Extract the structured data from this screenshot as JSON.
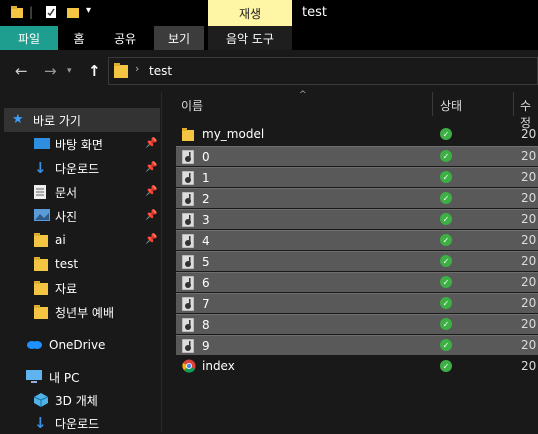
{
  "titlebar": {
    "contextual_tab": "재생",
    "title": "test"
  },
  "ribbon": {
    "tabs": [
      "파일",
      "홈",
      "공유",
      "보기",
      "음악 도구"
    ]
  },
  "address": {
    "path": "test"
  },
  "sidebar": {
    "quick_access": "바로 가기",
    "items": [
      {
        "label": "바탕 화면",
        "icon": "desktop-icon",
        "pinned": true
      },
      {
        "label": "다운로드",
        "icon": "download-icon",
        "pinned": true
      },
      {
        "label": "문서",
        "icon": "document-icon",
        "pinned": true
      },
      {
        "label": "사진",
        "icon": "pictures-icon",
        "pinned": true
      },
      {
        "label": "ai",
        "icon": "folder-icon",
        "pinned": true
      },
      {
        "label": "test",
        "icon": "folder-icon",
        "pinned": false
      },
      {
        "label": "자료",
        "icon": "folder-icon",
        "pinned": false
      },
      {
        "label": "청년부 예배",
        "icon": "folder-icon",
        "pinned": false
      }
    ],
    "onedrive": "OneDrive",
    "this_pc": "내 PC",
    "pc_items": [
      {
        "label": "3D 개체",
        "icon": "3d-objects-icon"
      },
      {
        "label": "다운로드",
        "icon": "download-icon"
      }
    ]
  },
  "columns": {
    "name": "이름",
    "status": "상태",
    "modified": "수정"
  },
  "files": [
    {
      "name": "my_model",
      "type": "folder",
      "selected": false,
      "date": "20"
    },
    {
      "name": "0",
      "type": "audio",
      "selected": true,
      "date": "20"
    },
    {
      "name": "1",
      "type": "audio",
      "selected": true,
      "date": "20"
    },
    {
      "name": "2",
      "type": "audio",
      "selected": true,
      "date": "20"
    },
    {
      "name": "3",
      "type": "audio",
      "selected": true,
      "date": "20"
    },
    {
      "name": "4",
      "type": "audio",
      "selected": true,
      "date": "20"
    },
    {
      "name": "5",
      "type": "audio",
      "selected": true,
      "date": "20"
    },
    {
      "name": "6",
      "type": "audio",
      "selected": true,
      "date": "20"
    },
    {
      "name": "7",
      "type": "audio",
      "selected": true,
      "date": "20"
    },
    {
      "name": "8",
      "type": "audio",
      "selected": true,
      "date": "20"
    },
    {
      "name": "9",
      "type": "audio",
      "selected": true,
      "date": "20"
    },
    {
      "name": "index",
      "type": "chrome",
      "selected": false,
      "date": "20"
    }
  ],
  "colors": {
    "accent": "#1d9e8f",
    "context_tab": "#fff6a5",
    "selection": "#595959",
    "status_ok": "#3cb043"
  }
}
